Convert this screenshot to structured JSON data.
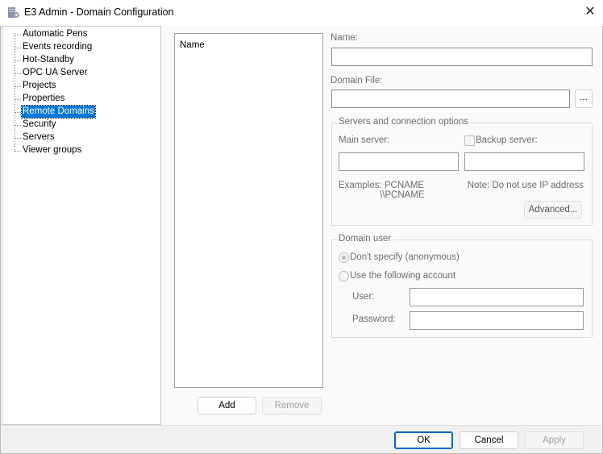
{
  "window": {
    "title": "E3 Admin - Domain Configuration",
    "close_glyph": "✕"
  },
  "tree": {
    "items": [
      {
        "label": "Automatic Pens",
        "selected": false
      },
      {
        "label": "Events recording",
        "selected": false
      },
      {
        "label": "Hot-Standby",
        "selected": false
      },
      {
        "label": "OPC UA Server",
        "selected": false
      },
      {
        "label": "Projects",
        "selected": false
      },
      {
        "label": "Properties",
        "selected": false
      },
      {
        "label": "Remote Domains",
        "selected": true
      },
      {
        "label": "Security",
        "selected": false
      },
      {
        "label": "Servers",
        "selected": false
      },
      {
        "label": "Viewer groups",
        "selected": false
      }
    ]
  },
  "domain_list": {
    "header": "Name",
    "add_label": "Add",
    "remove_label": "Remove"
  },
  "form": {
    "name_label": "Name:",
    "name_value": "",
    "domain_file_label": "Domain File:",
    "domain_file_value": "",
    "browse_label": "...",
    "servers_group": {
      "title": "Servers and connection options",
      "main_server_label": "Main server:",
      "main_server_value": "",
      "backup_server_label": "Backup server:",
      "backup_checked": false,
      "backup_server_value": "",
      "examples_label": "Examples: PCNAME",
      "examples_line2": "\\\\PCNAME",
      "note": "Note: Do not use IP address",
      "advanced_label": "Advanced..."
    },
    "user_group": {
      "title": "Domain user",
      "radio_anonymous": "Don't specify (anonymous)",
      "radio_account": "Use the following account",
      "selected": "anonymous",
      "user_label": "User:",
      "user_value": "",
      "password_label": "Password:",
      "password_value": ""
    }
  },
  "footer": {
    "ok": "OK",
    "cancel": "Cancel",
    "apply": "Apply"
  }
}
